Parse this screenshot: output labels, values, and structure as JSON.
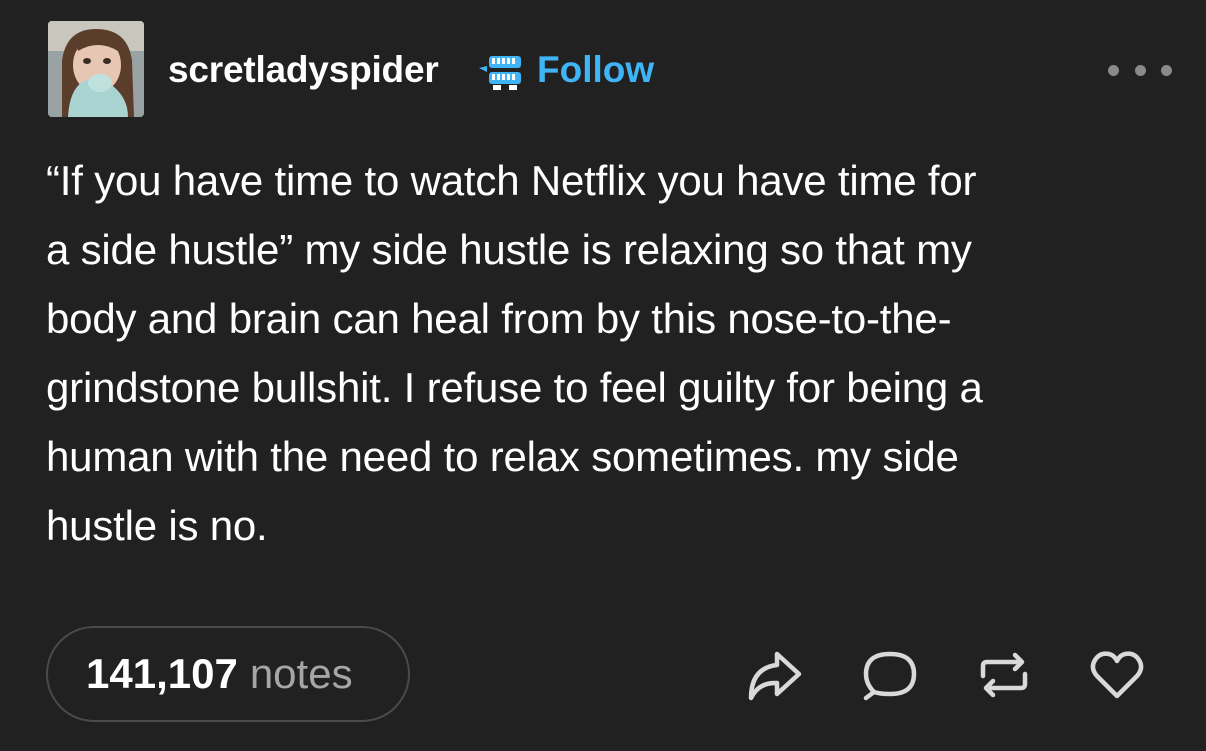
{
  "post": {
    "username": "scretladyspider",
    "follow_label": "Follow",
    "text_lines": [
      "“If you have time to watch Netflix you have time for",
      "a side hustle” my side hustle is relaxing so that my",
      "body and brain can heal from by this nose-to-the-",
      "grindstone bullshit. I refuse to feel guilty for being a",
      "human with the need to relax sometimes. my side",
      "hustle is no."
    ],
    "notes_count": "141,107",
    "notes_label": "notes"
  },
  "icons": {
    "more": "more-options-icon",
    "badge": "chattering-teeth-badge-icon",
    "share": "share-icon",
    "reply": "reply-icon",
    "reblog": "reblog-icon",
    "like": "heart-icon"
  },
  "colors": {
    "background": "#212121",
    "text": "#ffffff",
    "follow": "#3fb5f8",
    "muted": "#a6a6a6",
    "icon": "#d9d9d9"
  }
}
